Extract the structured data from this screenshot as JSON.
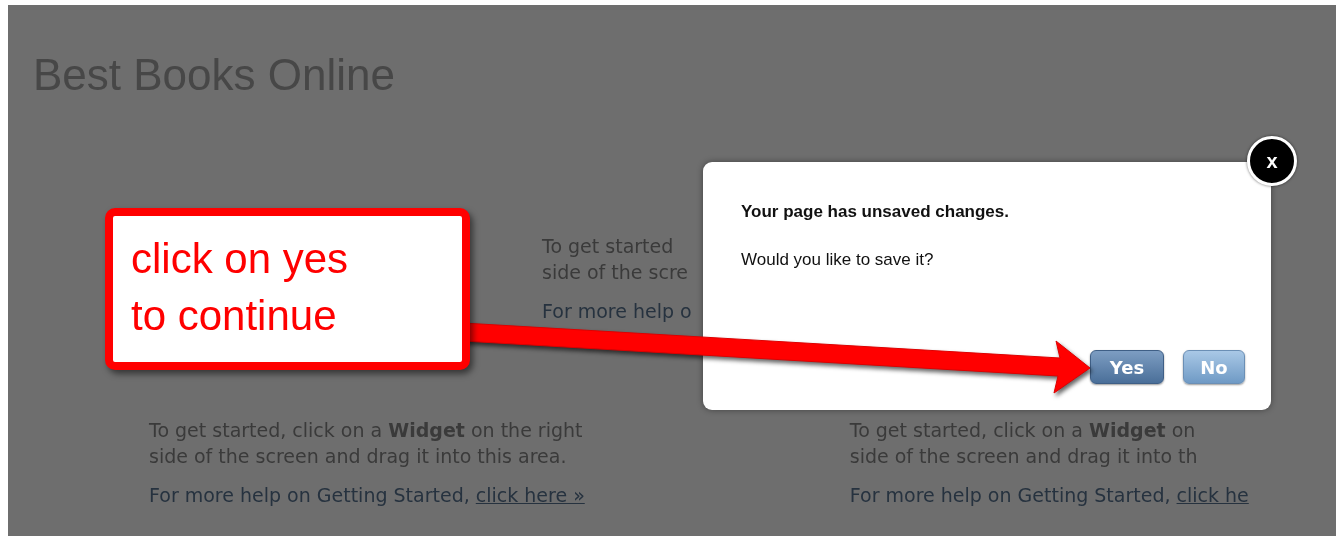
{
  "page": {
    "title": "Best Books Online",
    "widget_areas": [
      {
        "lines": [
          "To get started",
          "side of the scre"
        ],
        "help_text": "For more help o"
      },
      {
        "lines": [
          "To get started, click on a **Widget** on the right",
          "side of the screen and drag it into this area."
        ],
        "help_text": "For more help on Getting Started, ",
        "help_link": "click here »"
      },
      {
        "lines": [
          "To get started, click on a **Widget** on",
          "side of the screen and drag it into th"
        ],
        "help_text": "For more help on Getting Started, ",
        "help_link": "click he"
      }
    ]
  },
  "dialog": {
    "close_label": "x",
    "heading": "Your page has unsaved changes.",
    "message": "Would you like to save it?",
    "buttons": [
      {
        "label": "Yes",
        "kind": "primary"
      },
      {
        "label": "No",
        "kind": "secondary"
      }
    ]
  },
  "callout": {
    "lines": [
      "click on yes",
      "to continue"
    ]
  }
}
